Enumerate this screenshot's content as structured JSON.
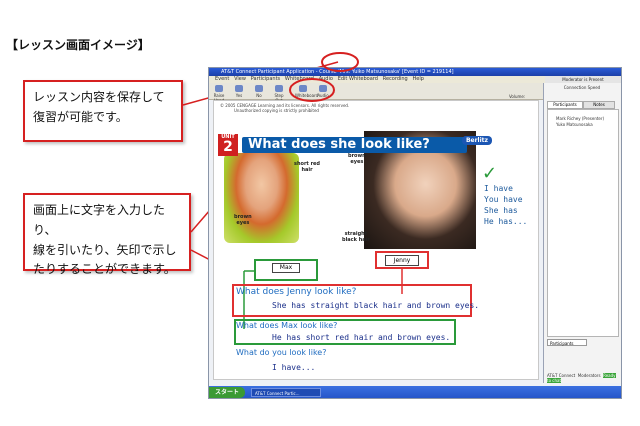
{
  "heading": "【レッスン画面イメージ】",
  "callouts": {
    "save_lines": [
      "レッスン内容を保存して",
      "復習が可能です。"
    ],
    "draw_lines": [
      "画面上に文字を入力したり、",
      "線を引いたり、矢印で示し",
      "たりすることができます。"
    ]
  },
  "app": {
    "title": "AT&T Connect Participant Application - Course 'Mrs. Yuiko Matsunosaka' [Event ID = 219114]",
    "menu": [
      "Event",
      "View",
      "Participants",
      "Whiteboard",
      "Audio",
      "Edit Whiteboard",
      "Recording",
      "Help"
    ],
    "toolbar": [
      "Raise Hand",
      "Yes",
      "No",
      "Step Out",
      "Whiteboard",
      "Audio"
    ],
    "moderator_label": "Moderator is Present",
    "connection_label": "Connection Speed",
    "volume_label": "Volume:",
    "tabs": [
      "Participants",
      "Notes"
    ],
    "participants": [
      "Mark Richey (Presenter)",
      "Yuko Matsunosaka"
    ],
    "participants_dropdown": "Participants",
    "status": [
      "AT&T Connect",
      "Moderators",
      "Ready to chat"
    ],
    "taskbar": {
      "start": "スタート",
      "task": "AT&T Connect Partic..."
    }
  },
  "lesson": {
    "copyright_line1": "© 2005 CENGAGE Learning and its licensors. All rights reserved.",
    "copyright_line2": "Unauthorized copying is strictly prohibited",
    "unit_label": "UNIT",
    "unit_number": "2",
    "question": "What does she look like?",
    "brand": "Berlitz",
    "labels": {
      "short_red_hair": [
        "short red",
        "hair"
      ],
      "brown_eyes_boy": [
        "brown",
        "eyes"
      ],
      "brown_eyes_girl": [
        "brown",
        "eyes"
      ],
      "straight_black_hair": [
        "straight",
        "black hair"
      ]
    },
    "name_max": "Max",
    "name_jenny": "Jenny",
    "check_mark": "✓",
    "side_notes": [
      "I have",
      "You have",
      "She has",
      "He has..."
    ],
    "q_jenny": "What does Jenny look like?",
    "a_jenny": "She has straight black hair and brown eyes.",
    "q_max": "What does Max look like?",
    "a_max": "He has short red hair and brown eyes.",
    "q_you": "What do you look like?",
    "a_you": "I have..."
  },
  "colors": {
    "accent_red": "#d62020",
    "highlight_green": "#2a9a3a",
    "question_blue": "#1f6cc0"
  }
}
